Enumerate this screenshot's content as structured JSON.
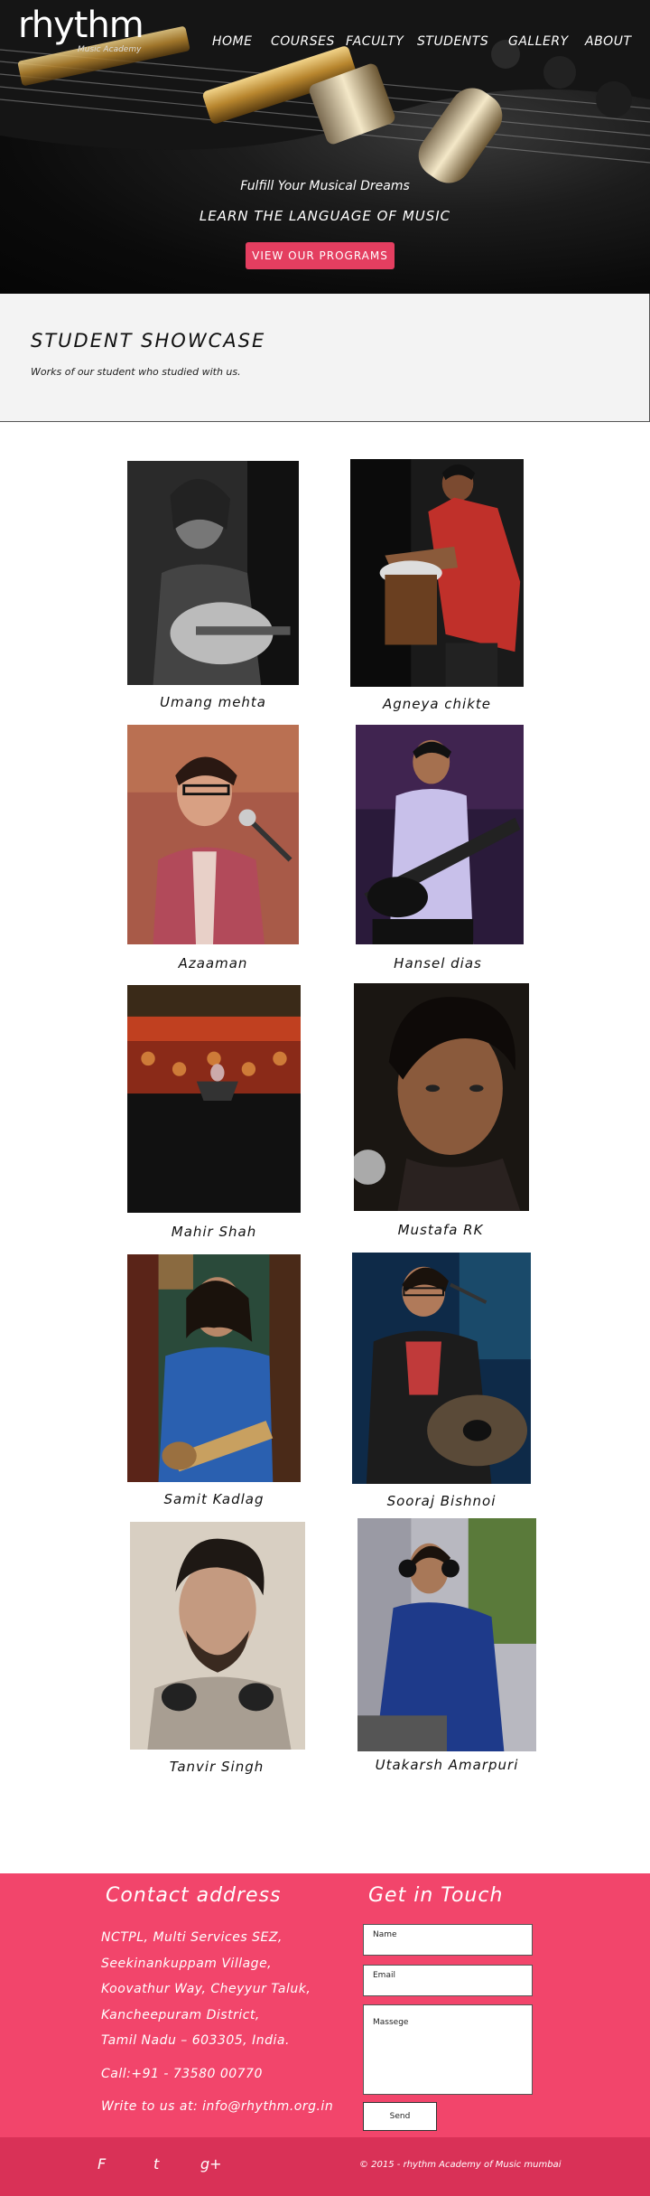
{
  "brand": {
    "logo_text": "rhythm",
    "logo_sub": "Music Academy"
  },
  "nav": {
    "items": [
      "HOME",
      "COURSES",
      "FACULTY",
      "STUDENTS",
      "GALLERY",
      "ABOUT"
    ]
  },
  "hero": {
    "tagline": "Fulfill Your Musical Dreams",
    "subtitle": "LEARN THE LANGUAGE OF MUSIC",
    "cta": "VIEW OUR PROGRAMS"
  },
  "showcase": {
    "title": "STUDENT SHOWCASE",
    "description": "Works of our student who studied with us."
  },
  "students": [
    "Umang mehta",
    "Agneya chikte",
    "Azaaman",
    "Hansel dias",
    "Mahir Shah",
    "Mustafa RK",
    "Samit Kadlag",
    "Sooraj Bishnoi",
    "Tanvir Singh",
    "Utakarsh Amarpuri"
  ],
  "footer": {
    "contact_title": "Contact address",
    "address_lines": [
      "NCTPL, Multi Services SEZ,",
      "Seekinankuppam Village,",
      "Koovathur Way, Cheyyur Taluk,",
      "Kancheepuram District,",
      "Tamil Nadu – 603305, India."
    ],
    "phone": "Call:+91 - 73580 00770",
    "email": "Write to us at: info@rhythm.org.in",
    "touch_title": "Get in Touch",
    "form": {
      "name": "Name",
      "email": "Email",
      "message": "Massege",
      "send": "Send"
    },
    "social": [
      "F",
      "t",
      "g+"
    ],
    "copyright": "© 2015 - rhythm Academy of Music mumbai"
  },
  "colors": {
    "accent": "#f2456b",
    "accent_dark": "#d93157",
    "cta": "#e43e60"
  }
}
